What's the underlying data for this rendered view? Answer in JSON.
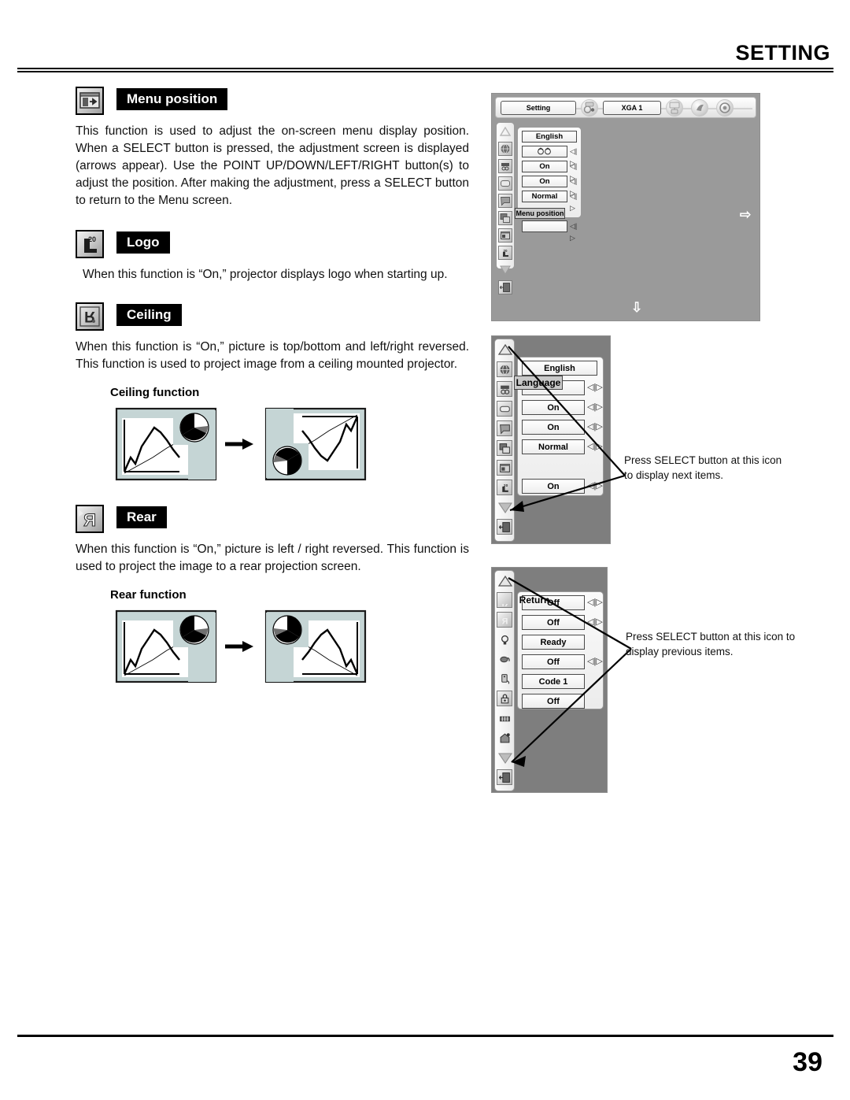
{
  "header": {
    "title": "SETTING"
  },
  "footer": {
    "page_number": "39"
  },
  "sections": [
    {
      "id": "menu-position",
      "icon_name": "menu-position-icon",
      "label": "Menu position",
      "body": "This function is used to adjust the on-screen menu display position. When a SELECT button is pressed, the adjustment screen is displayed (arrows appear). Use the POINT UP/DOWN/LEFT/RIGHT button(s) to adjust the position. After making the adjustment, press a SELECT button to return to the Menu screen."
    },
    {
      "id": "logo",
      "icon_name": "logo-icon",
      "icon_text_top": "20",
      "icon_text_main": "L",
      "label": "Logo",
      "body": "When this function is “On,” projector displays logo when starting up."
    },
    {
      "id": "ceiling",
      "icon_name": "ceiling-icon",
      "label": "Ceiling",
      "body": "When this function is “On,” picture is top/bottom and left/right reversed. This function is used to project image from a ceiling mounted projector.",
      "figure_caption": "Ceiling function"
    },
    {
      "id": "rear",
      "icon_name": "rear-icon",
      "label": "Rear",
      "body": "When this function is “On,” picture is left / right reversed.  This function is used to project the image to a rear projection screen.",
      "figure_caption": "Rear function"
    }
  ],
  "osd_main": {
    "menubar": {
      "current_menu": "Setting",
      "input_source": "XGA 1",
      "icons": [
        "setting-gear-icon",
        "screen-icon",
        "sound-icon",
        "info-icon"
      ]
    },
    "sidebar_icons": [
      "scroll-up-icon",
      "language-globe-icon",
      "keystone-icon",
      "blue-back-icon",
      "display-icon",
      "logo-select-icon",
      "menu-position-icon",
      "logo-icon",
      "scroll-down-icon",
      "quit-door-icon"
    ],
    "items": [
      {
        "value": "English",
        "has_arrows": false
      },
      {
        "value": "",
        "icon": "keystone-glyph",
        "has_arrows": true
      },
      {
        "value": "On",
        "has_arrows": true
      },
      {
        "value": "On",
        "has_arrows": true
      },
      {
        "value": "Normal",
        "has_arrows": true
      },
      {
        "value": "",
        "has_arrows": false
      },
      {
        "value": "",
        "has_arrows": true
      }
    ],
    "highlight_label": "Menu position",
    "adjust_arrow_right": "⇨",
    "adjust_arrow_down": "⇩"
  },
  "osd_next": {
    "highlight_label": "Language",
    "sidebar_icons": [
      "scroll-up-icon",
      "language-globe-icon",
      "keystone-icon",
      "blue-back-icon",
      "display-icon",
      "logo-select-icon",
      "menu-position-icon",
      "logo-icon",
      "scroll-down-icon",
      "quit-door-icon"
    ],
    "items": [
      {
        "value": "English",
        "has_arrows": false
      },
      {
        "value": "",
        "has_arrows": true
      },
      {
        "value": "On",
        "has_arrows": true
      },
      {
        "value": "On",
        "has_arrows": true
      },
      {
        "value": "Normal",
        "has_arrows": true
      },
      {
        "value": "",
        "has_arrows": false
      },
      {
        "value": "On",
        "has_arrows": true
      }
    ],
    "callout": "Press SELECT button at this icon to display next items."
  },
  "osd_prev": {
    "highlight_label": "Return",
    "sidebar_icons": [
      "scroll-up-icon",
      "ceiling-icon",
      "rear-icon",
      "lamp-icon",
      "power-management-icon",
      "remote-control-icon",
      "key-lock-icon",
      "lamp-counter-icon",
      "factory-default-icon",
      "scroll-down-icon",
      "quit-door-icon"
    ],
    "items": [
      {
        "value": "Off",
        "has_arrows": true
      },
      {
        "value": "Off",
        "has_arrows": true
      },
      {
        "value": "Ready",
        "has_arrows": false
      },
      {
        "value": "Off",
        "has_arrows": true
      },
      {
        "value": "Code 1",
        "has_arrows": false
      },
      {
        "value": "Off",
        "has_arrows": false
      }
    ],
    "callout": "Press SELECT button at this icon to display previous items."
  },
  "colors": {
    "figure_fill": "#c5d5d5",
    "osd_background": "#9a9a9a",
    "osd_background_dark": "#7e7e7e",
    "tag_background": "#000000",
    "tag_text": "#ffffff"
  }
}
